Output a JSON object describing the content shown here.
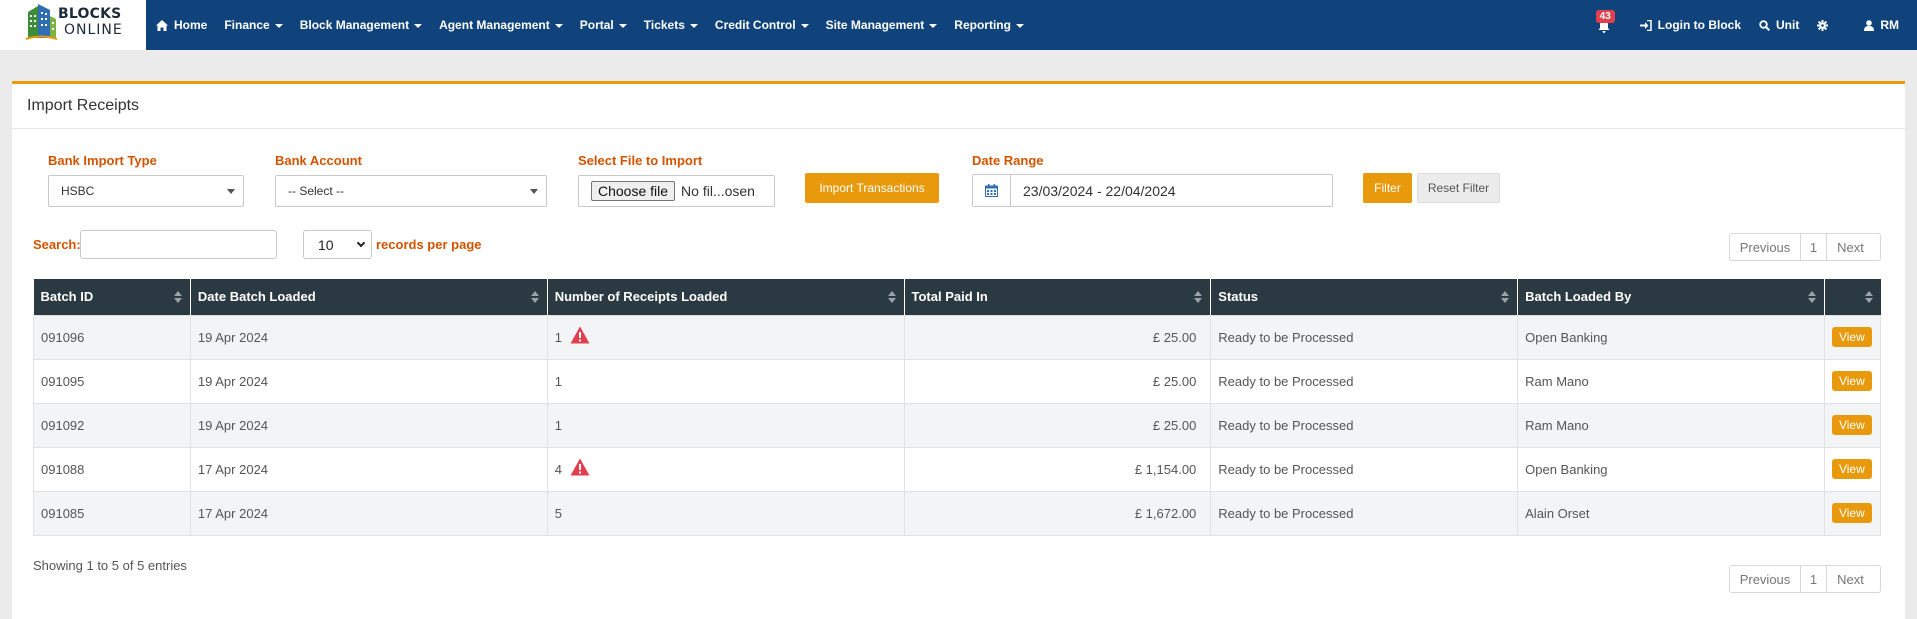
{
  "app": {
    "logo_line1": "BLOCKS",
    "logo_line2": "ONLINE"
  },
  "nav": {
    "items": [
      {
        "label": "Home",
        "icon": "home-icon"
      },
      {
        "label": "Finance",
        "dropdown": true
      },
      {
        "label": "Block Management",
        "dropdown": true
      },
      {
        "label": "Agent Management",
        "dropdown": true
      },
      {
        "label": "Portal",
        "dropdown": true
      },
      {
        "label": "Tickets",
        "dropdown": true
      },
      {
        "label": "Credit Control",
        "dropdown": true
      },
      {
        "label": "Site Management",
        "dropdown": true
      },
      {
        "label": "Reporting",
        "dropdown": true
      }
    ],
    "notifications_count": "43",
    "login_to_block": "Login to Block",
    "unit": "Unit",
    "user_initials": "RM"
  },
  "page": {
    "title": "Import Receipts"
  },
  "filters": {
    "bank_import_type_label": "Bank Import Type",
    "bank_import_type_value": "HSBC",
    "bank_account_label": "Bank Account",
    "bank_account_value": "-- Select --",
    "file_label": "Select File to Import",
    "file_button": "Choose file",
    "file_status": "No fil...osen",
    "import_button": "Import Transactions",
    "date_range_label": "Date Range",
    "date_range_value": "23/03/2024 - 22/04/2024",
    "filter_button": "Filter",
    "reset_button": "Reset Filter"
  },
  "table_controls": {
    "search_label": "Search:",
    "per_page_value": "10",
    "per_page_label": "records per page",
    "previous": "Previous",
    "page": "1",
    "next": "Next"
  },
  "table": {
    "columns": [
      "Batch ID",
      "Date Batch Loaded",
      "Number of Receipts Loaded",
      "Total Paid In",
      "Status",
      "Batch Loaded By",
      ""
    ],
    "rows": [
      {
        "batch_id": "091096",
        "date": "19 Apr 2024",
        "receipts": "1",
        "warning": true,
        "total": "£ 25.00",
        "status": "Ready to be Processed",
        "loaded_by": "Open Banking",
        "action": "View"
      },
      {
        "batch_id": "091095",
        "date": "19 Apr 2024",
        "receipts": "1",
        "warning": false,
        "total": "£ 25.00",
        "status": "Ready to be Processed",
        "loaded_by": "Ram Mano",
        "action": "View"
      },
      {
        "batch_id": "091092",
        "date": "19 Apr 2024",
        "receipts": "1",
        "warning": false,
        "total": "£ 25.00",
        "status": "Ready to be Processed",
        "loaded_by": "Ram Mano",
        "action": "View"
      },
      {
        "batch_id": "091088",
        "date": "17 Apr 2024",
        "receipts": "4",
        "warning": true,
        "total": "£ 1,154.00",
        "status": "Ready to be Processed",
        "loaded_by": "Open Banking",
        "action": "View"
      },
      {
        "batch_id": "091085",
        "date": "17 Apr 2024",
        "receipts": "5",
        "warning": false,
        "total": "£ 1,672.00",
        "status": "Ready to be Processed",
        "loaded_by": "Alain Orset",
        "action": "View"
      }
    ],
    "summary": "Showing 1 to 5 of 5 entries"
  },
  "colors": {
    "navbar": "#10437b",
    "accent": "#e89a0c",
    "label": "#d35400",
    "table_header": "#2b3a42",
    "warning": "#e0404e"
  }
}
